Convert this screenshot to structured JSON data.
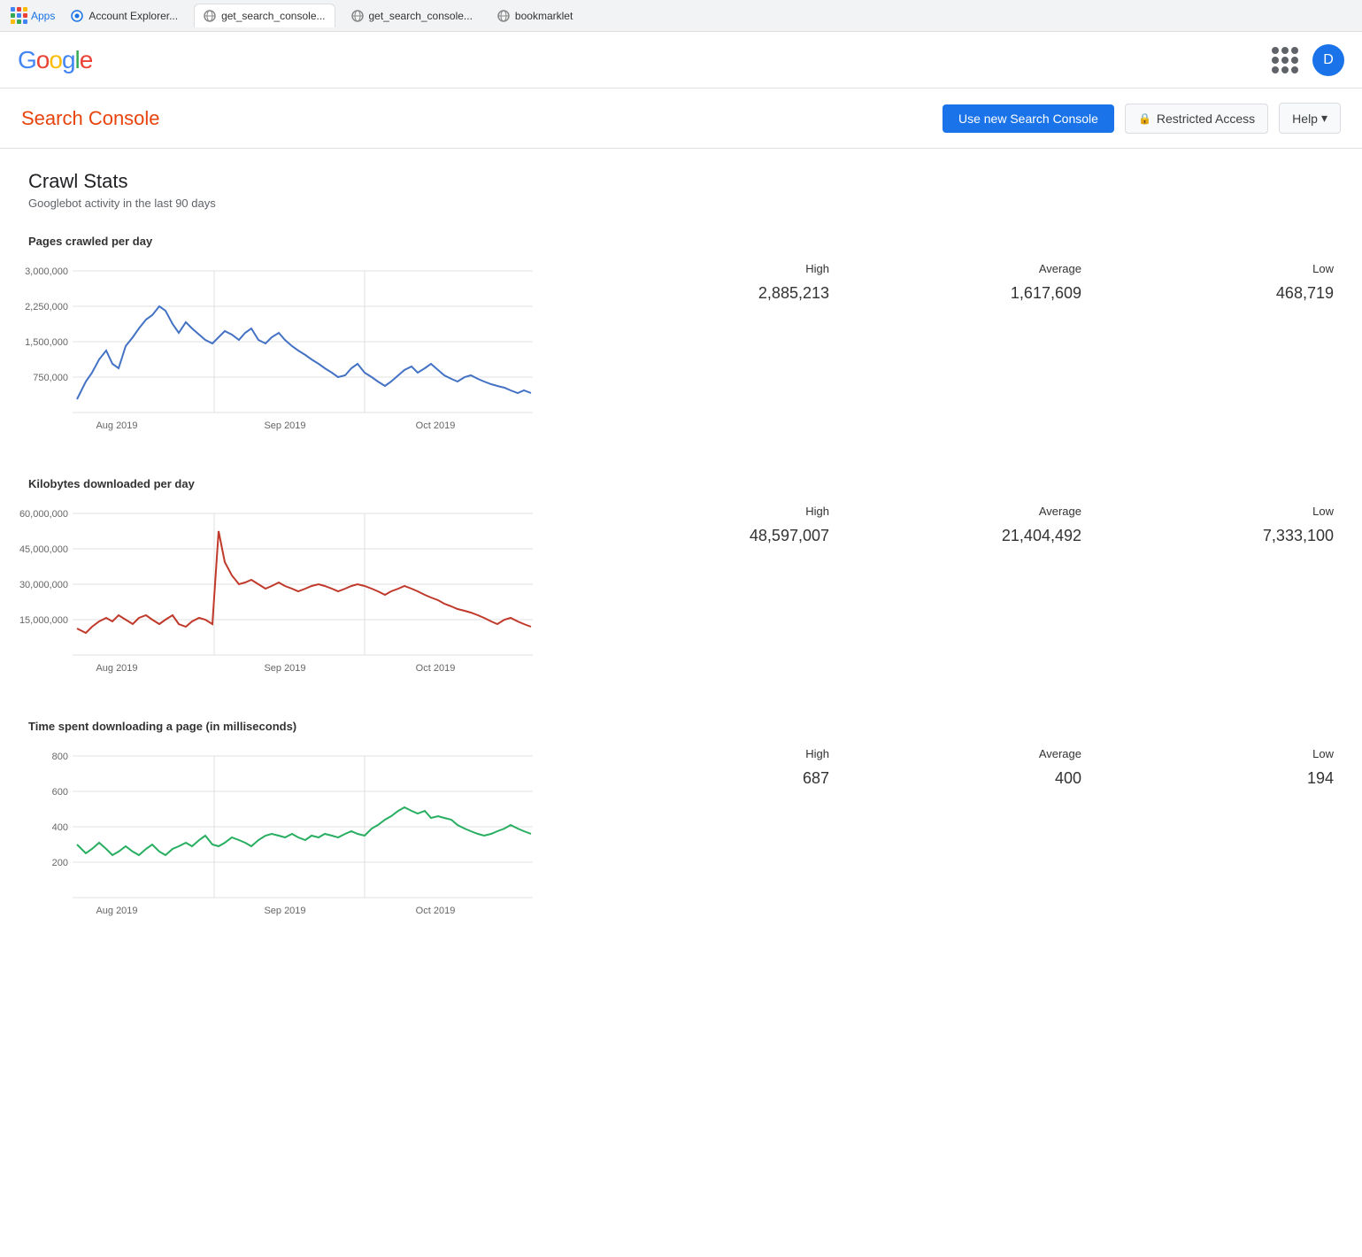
{
  "browser": {
    "tabs": [
      {
        "label": "Apps",
        "icon": "apps",
        "active": false
      },
      {
        "label": "Account Explorer...",
        "icon": "chrome",
        "active": false
      },
      {
        "label": "get_search_console...",
        "icon": "globe",
        "active": true
      },
      {
        "label": "get_search_console...",
        "icon": "globe",
        "active": false
      },
      {
        "label": "bookmarklet",
        "icon": "globe",
        "active": false
      }
    ]
  },
  "header": {
    "logo": "Google",
    "user_initial": "D"
  },
  "sc_header": {
    "title": "Search Console",
    "btn_new": "Use new Search Console",
    "btn_restricted": "Restricted Access",
    "btn_help": "Help"
  },
  "page": {
    "title": "Crawl Stats",
    "subtitle": "Googlebot activity in the last 90 days"
  },
  "charts": [
    {
      "label": "Pages crawled per day",
      "high_label": "High",
      "avg_label": "Average",
      "low_label": "Low",
      "high": "2,885,213",
      "average": "1,617,609",
      "low": "468,719",
      "color": "#4472C4",
      "y_labels": [
        "3,000,000",
        "2,250,000",
        "1,500,000",
        "750,000"
      ],
      "x_labels": [
        "Aug 2019",
        "Sep 2019",
        "Oct 2019"
      ]
    },
    {
      "label": "Kilobytes downloaded per day",
      "high_label": "High",
      "avg_label": "Average",
      "low_label": "Low",
      "high": "48,597,007",
      "average": "21,404,492",
      "low": "7,333,100",
      "color": "#C0392B",
      "y_labels": [
        "60,000,000",
        "45,000,000",
        "30,000,000",
        "15,000,000"
      ],
      "x_labels": [
        "Aug 2019",
        "Sep 2019",
        "Oct 2019"
      ]
    },
    {
      "label": "Time spent downloading a page (in milliseconds)",
      "high_label": "High",
      "avg_label": "Average",
      "low_label": "Low",
      "high": "687",
      "average": "400",
      "low": "194",
      "color": "#27AE60",
      "y_labels": [
        "800",
        "600",
        "400",
        "200"
      ],
      "x_labels": [
        "Aug 2019",
        "Sep 2019",
        "Oct 2019"
      ]
    }
  ]
}
